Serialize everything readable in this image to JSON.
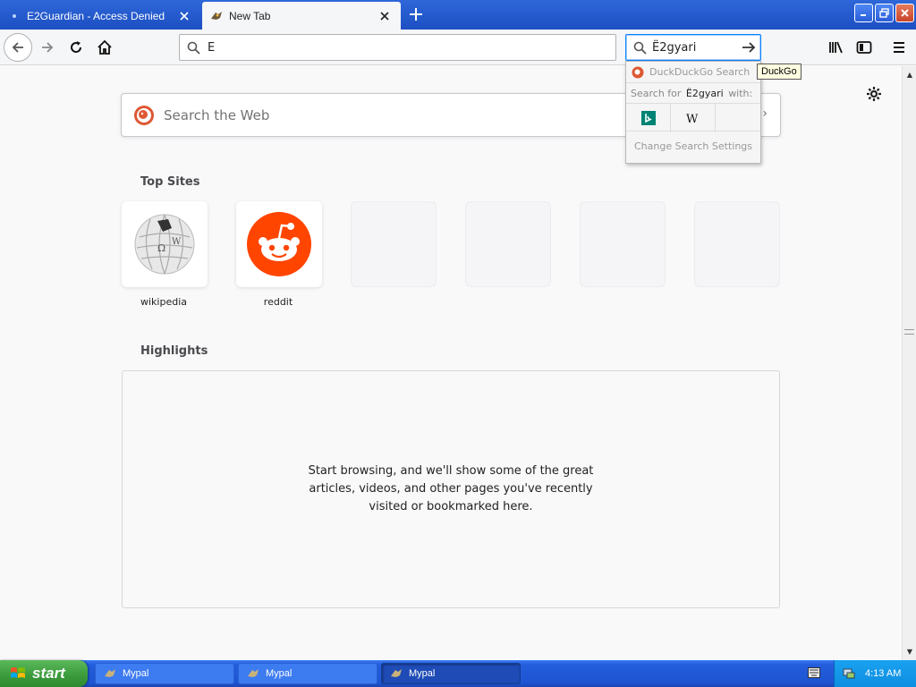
{
  "tabs": [
    {
      "title": "E2Guardian - Access Denied",
      "active": false
    },
    {
      "title": "New Tab",
      "active": true
    }
  ],
  "window_controls": {
    "minimize": "_",
    "restore": "❐",
    "close": "✕"
  },
  "toolbar": {
    "url_value": "E",
    "search_value": "Ë2gyari"
  },
  "search_popup": {
    "engine_name": "DuckDuckGo Search",
    "search_for_prefix": "Search for",
    "search_for_term": "Ë2gyari",
    "search_for_suffix": "with:",
    "change_settings": "Change Search Settings",
    "alt_engines": [
      "bing-icon",
      "wikipedia-icon"
    ]
  },
  "tooltip": "DuckGo",
  "newtab": {
    "search_placeholder": "Search the Web",
    "top_sites_title": "Top Sites",
    "top_sites": [
      {
        "label": "wikipedia"
      },
      {
        "label": "reddit"
      },
      {
        "label": ""
      },
      {
        "label": ""
      },
      {
        "label": ""
      },
      {
        "label": ""
      }
    ],
    "highlights_title": "Highlights",
    "highlights_message": "Start browsing, and we'll show some of the great articles, videos, and other pages you've recently visited or bookmarked here."
  },
  "taskbar": {
    "start_label": "start",
    "tasks": [
      {
        "label": "Mypal",
        "active": false
      },
      {
        "label": "Mypal",
        "active": false
      },
      {
        "label": "Mypal",
        "active": true
      }
    ],
    "clock": "4:13 AM"
  },
  "colors": {
    "accent": "#0a84ff",
    "reddit": "#ff4500",
    "ddg": "#de5833",
    "xp_blue": "#245edc",
    "xp_green": "#3a9a3a"
  }
}
